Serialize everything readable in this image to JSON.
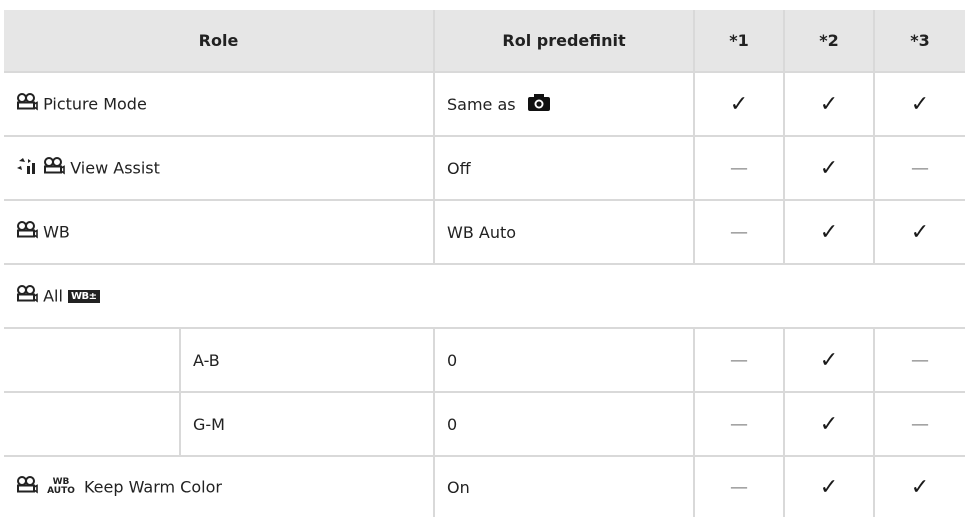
{
  "headers": {
    "role": "Role",
    "default": "Rol predefinit",
    "c1": "*1",
    "c2": "*2",
    "c3": "*3"
  },
  "marks": {
    "check": "✓",
    "dash": "—"
  },
  "rows": [
    {
      "label": "Picture Mode",
      "default": "Same as",
      "icons": [
        "movie-icon"
      ],
      "default_icon": "camera-icon",
      "c1": "check",
      "c2": "check",
      "c3": "check"
    },
    {
      "label": "View Assist",
      "default": "Off",
      "icons": [
        "view-assist-icon",
        "movie-icon"
      ],
      "c1": "dash",
      "c2": "check",
      "c3": "dash"
    },
    {
      "label": "WB",
      "default": "WB Auto",
      "icons": [
        "movie-icon"
      ],
      "c1": "dash",
      "c2": "check",
      "c3": "check"
    },
    {
      "label": "All",
      "icons": [
        "movie-icon",
        "wb-compensation-icon"
      ],
      "wb_badge": "WB±"
    },
    {
      "sublabel": "A-B",
      "default": "0",
      "c1": "dash",
      "c2": "check",
      "c3": "dash"
    },
    {
      "sublabel": "G-M",
      "default": "0",
      "c1": "dash",
      "c2": "check",
      "c3": "dash"
    },
    {
      "label": "Keep Warm Color",
      "default": "On",
      "icons": [
        "movie-icon",
        "wb-auto-icon"
      ],
      "wb_auto_top": "WB",
      "wb_auto_bottom": "AUTO",
      "c1": "dash",
      "c2": "check",
      "c3": "check"
    }
  ]
}
